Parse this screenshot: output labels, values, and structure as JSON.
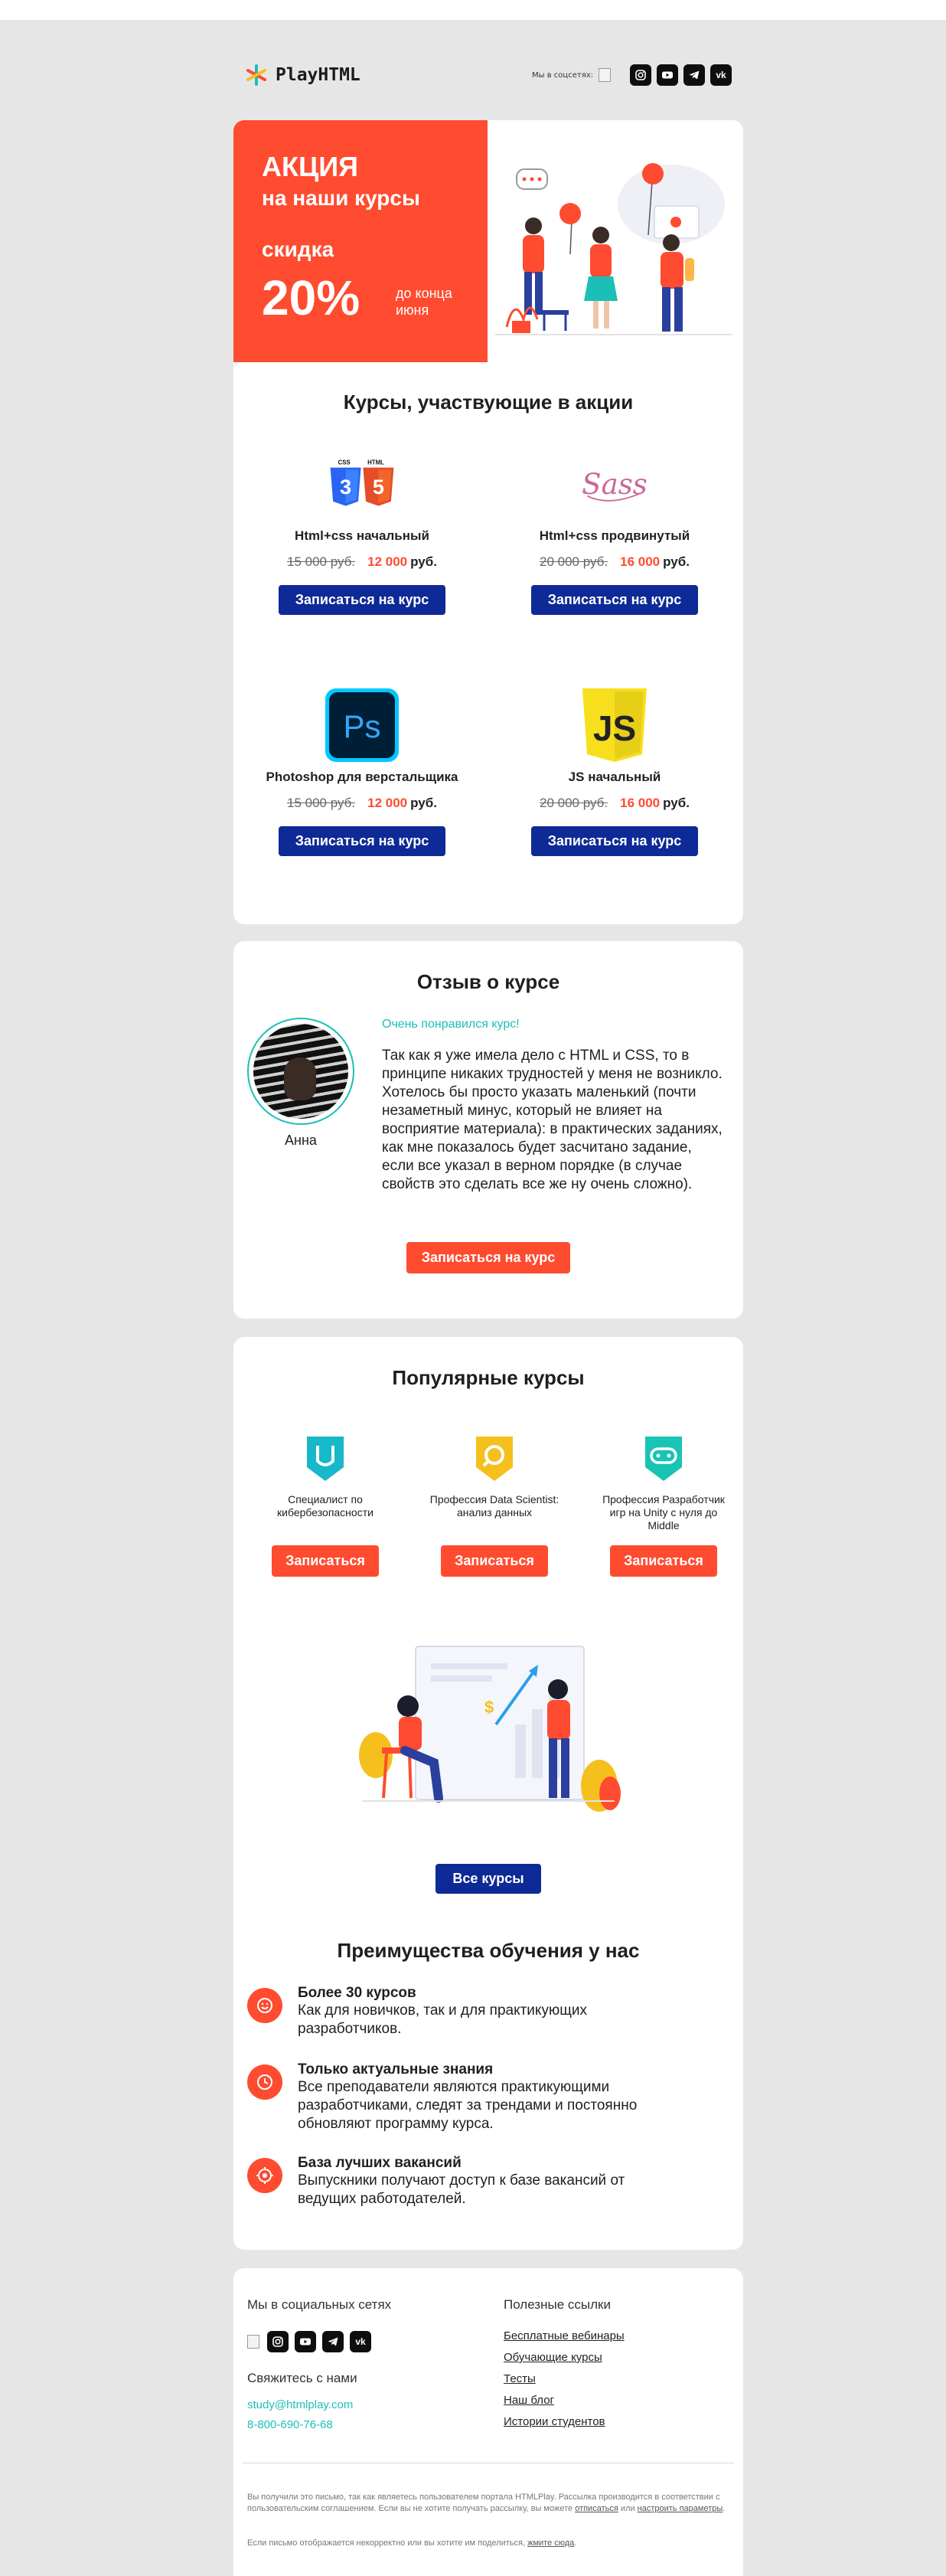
{
  "header": {
    "logo_text": "PlayHTML",
    "social_label": "Мы в соцсетях:",
    "social_icons": [
      "instagram-icon",
      "youtube-icon",
      "telegram-icon",
      "vk-icon"
    ]
  },
  "promo": {
    "title": "АКЦИЯ",
    "line2": "на наши курсы",
    "line3": "скидка",
    "percent": "20%",
    "until": "до конца июня"
  },
  "courses_section": {
    "title": "Курсы, участвующие в акции",
    "items": [
      {
        "name": "Html+css начальный",
        "old_price": "15 000 руб.",
        "new_price": "12 000",
        "currency": "руб.",
        "button": "Записаться на курс",
        "icon": "css-html-icon"
      },
      {
        "name": "Html+css продвинутый",
        "old_price": "20 000 руб.",
        "new_price": "16 000",
        "currency": "руб.",
        "button": "Записаться на курс",
        "icon": "sass-icon"
      },
      {
        "name": "Photoshop для верстальщика",
        "old_price": "15 000 руб.",
        "new_price": "12 000",
        "currency": "руб.",
        "button": "Записаться на курс",
        "icon": "photoshop-icon"
      },
      {
        "name": "JS начальный",
        "old_price": "20 000 руб.",
        "new_price": "16 000",
        "currency": "руб.",
        "button": "Записаться на курс",
        "icon": "js-icon"
      }
    ]
  },
  "review": {
    "title": "Отзыв о курсе",
    "name": "Анна",
    "headline": "Очень понравился курс!",
    "text": "Так как я уже имела дело с HTML и CSS, то в принципе никаких трудностей у меня не возникло. Хотелось бы просто указать маленький (почти незаметный минус, который не влияет на восприятие материала): в практических заданиях, как мне показалось будет засчитано задание, если все указал в верном порядке (в случае свойств это сделать все же ну очень сложно).",
    "button": "Записаться на курс"
  },
  "popular": {
    "title": "Популярные курсы",
    "items": [
      {
        "name": "Специалист по кибербезопасности",
        "button": "Записаться",
        "color": "#17b8c9"
      },
      {
        "name": "Профессия Data Scientist: анализ данных",
        "button": "Записаться",
        "color": "#f5c01e"
      },
      {
        "name": "Профессия Разработчик игр на Unity с нуля до Middle",
        "button": "Записаться",
        "color": "#18c4b4"
      }
    ],
    "all_button": "Все курсы"
  },
  "advantages": {
    "title": "Преимущества обучения у нас",
    "items": [
      {
        "head": "Более 30 курсов",
        "text": "Как для новичков, так и для практикующих разработчиков."
      },
      {
        "head": "Только актуальные знания",
        "text": "Все преподаватели являются практикующими разработчиками, следят за трендами и постоянно обновляют программу курса."
      },
      {
        "head": "База лучших вакансий",
        "text": "Выпускники получают доступ к базе вакансий от ведущих работодателей."
      }
    ]
  },
  "footer": {
    "social_title": "Мы в социальных сетях",
    "contact_title": "Свяжитесь с нами",
    "email": "study@htmlplay.com",
    "phone": "8-800-690-76-68",
    "links_title": "Полезные ссылки",
    "links": [
      "Бесплатные вебинары",
      "Обучающие курсы",
      "Тесты",
      "Наш блог",
      "Истории студентов"
    ],
    "disclaimer_1": "Вы получили это письмо, так как являетесь пользователем портала HTMLPlay. Рассылка производится в соответствии с пользовательским соглашением. Если вы не хотите получать рассылку, вы можете",
    "unsubscribe": "отписаться",
    "or": "или",
    "settings": "настроить параметры",
    "disclaimer_2": "Если письмо отображается некорректно или вы хотите им поделиться,",
    "press_here": "жмите сюда"
  },
  "colors": {
    "accent": "#ff4b2f",
    "primary": "#0e2a96",
    "teal": "#1bbfb8"
  }
}
